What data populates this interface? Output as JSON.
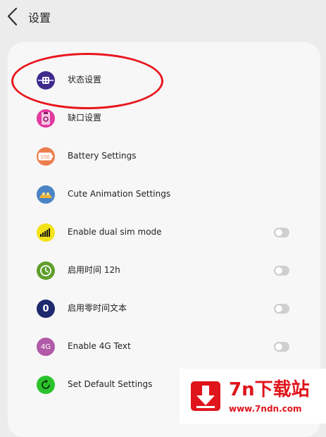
{
  "header": {
    "title": "设置"
  },
  "settings": [
    {
      "label": "状态设置",
      "icon": "statusbar-settings-icon",
      "icon_color": "#3f2a8c",
      "has_toggle": false
    },
    {
      "label": "缺口设置",
      "icon": "notch-settings-icon",
      "icon_color": "#e23aa0",
      "has_toggle": false
    },
    {
      "label": "Battery Settings",
      "icon": "battery-icon",
      "icon_color": "#ec7d4d",
      "has_toggle": false
    },
    {
      "label": "Cute Animation Settings",
      "icon": "animation-icon",
      "icon_color": "#4b84c4",
      "has_toggle": false
    },
    {
      "label": "Enable dual sim mode",
      "icon": "signal-bars-icon",
      "icon_color": "#f3e21a",
      "has_toggle": true,
      "toggle_on": false
    },
    {
      "label": "启用时间 12h",
      "icon": "clock-icon",
      "icon_color": "#5e9e2a",
      "has_toggle": true,
      "toggle_on": false
    },
    {
      "label": "启用零时间文本",
      "icon": "zero-icon",
      "icon_color": "#1d2a6e",
      "has_toggle": true,
      "toggle_on": false
    },
    {
      "label": "Enable 4G Text",
      "icon": "4g-icon",
      "icon_color": "#b05aa8",
      "has_toggle": true,
      "toggle_on": false
    },
    {
      "label": "Set Default Settings",
      "icon": "reset-icon",
      "icon_color": "#2bc22b",
      "has_toggle": false
    }
  ],
  "icon_texts": {
    "battery": "100",
    "zero": "0",
    "fourg": "4G"
  },
  "watermark": {
    "title": "7n下载站",
    "url": "www.7ndn.com"
  },
  "colors": {
    "highlight": "#e8161d",
    "watermark": "#e0141b"
  }
}
